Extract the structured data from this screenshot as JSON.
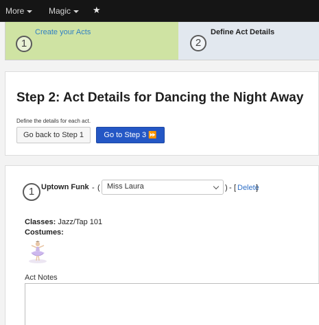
{
  "nav": {
    "more_label": "More",
    "magic_label": "Magic"
  },
  "steps": [
    {
      "number": "1",
      "label": "Create your Acts"
    },
    {
      "number": "2",
      "label": "Define Act Details"
    }
  ],
  "header": {
    "title": "Step 2: Act Details for Dancing the Night Away",
    "description": "Define the details for each act.",
    "back_button": "Go back to Step 1",
    "next_button": "Go to Step 3",
    "next_icon": "⏩"
  },
  "act": {
    "number": "1",
    "name": "Uptown Funk",
    "separator": "-",
    "teacher_selected": "Miss Laura",
    "delete_label": "Delete",
    "classes_label": "Classes:",
    "classes_value": "Jazz/Tap 101",
    "costumes_label": "Costumes:",
    "notes_label": "Act Notes",
    "notes_value": ""
  },
  "colors": {
    "step_active": "#cfe3a3",
    "step_inactive": "#e2e8ef",
    "primary_button": "#2457c5",
    "link": "#2f6fc6"
  }
}
